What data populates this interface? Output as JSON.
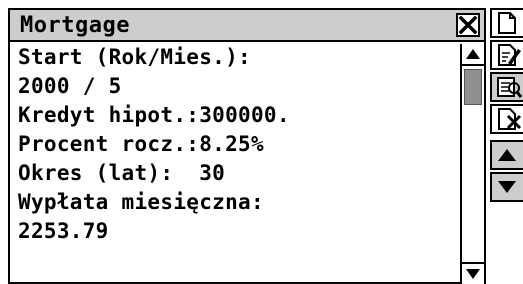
{
  "window": {
    "title": "Mortgage"
  },
  "content": {
    "lines": [
      "Start (Rok/Mies.):",
      "2000 / 5",
      "Kredyt hipot.:300000.",
      "Procent rocz.:8.25%",
      "Okres (lat):  30",
      "Wypłata miesięczna:",
      "2253.79"
    ]
  },
  "scrollbar": {
    "position_fraction": 0.0
  },
  "toolbar": {
    "icons": [
      "new-document-icon",
      "edit-document-icon",
      "view-document-icon",
      "delete-document-icon",
      "scroll-up-icon",
      "scroll-down-icon"
    ]
  },
  "colors": {
    "titlebar": "#cdcdcd",
    "scroll_thumb": "#8f8f8f",
    "text": "#000000",
    "background": "#ffffff"
  }
}
